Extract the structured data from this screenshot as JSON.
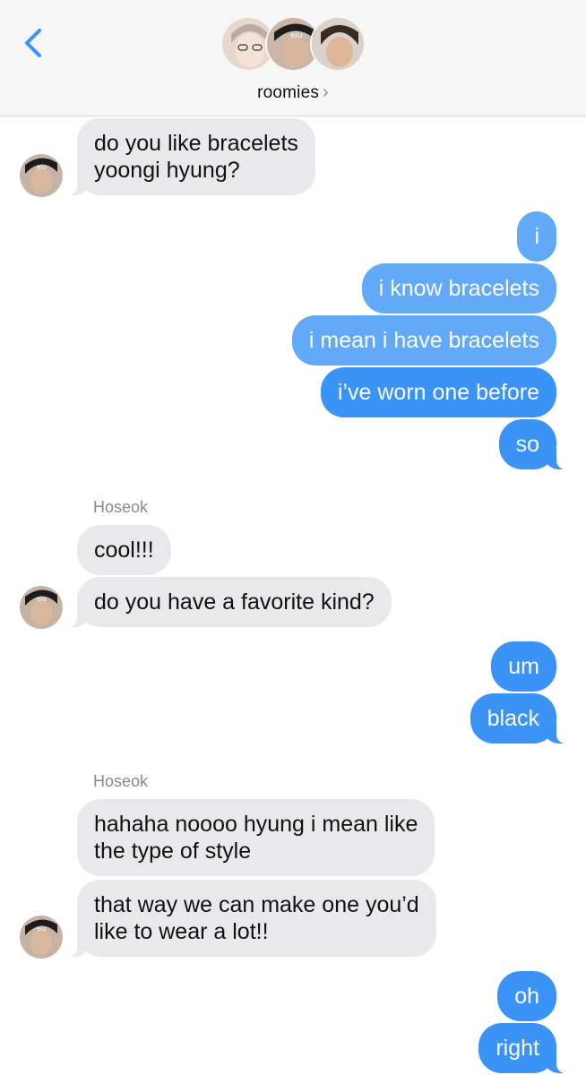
{
  "header": {
    "group_name": "roomies",
    "chevron": "›",
    "back_icon": "chevron-left-icon",
    "accent": "#3b93f5"
  },
  "messages": [
    {
      "from": "other",
      "text_lines": [
        "do you like bracelets",
        "yoongi hyung?"
      ]
    },
    {
      "from": "me",
      "text": "i"
    },
    {
      "from": "me",
      "text": "i know bracelets"
    },
    {
      "from": "me",
      "text": "i mean i have bracelets"
    },
    {
      "from": "me",
      "text": "i’ve worn one before"
    },
    {
      "from": "me",
      "text": "so"
    },
    {
      "sender": "Hoseok"
    },
    {
      "from": "other",
      "text": "cool!!!"
    },
    {
      "from": "other",
      "text": "do you have a favorite kind?"
    },
    {
      "from": "me",
      "text": "um"
    },
    {
      "from": "me",
      "text": "black"
    },
    {
      "sender": "Hoseok"
    },
    {
      "from": "other",
      "text_lines": [
        "hahaha noooo hyung i mean like",
        "the type of style"
      ]
    },
    {
      "from": "other",
      "text_lines": [
        "that way we can make one you’d",
        "like to wear a lot!!"
      ]
    },
    {
      "from": "me",
      "text": "oh"
    },
    {
      "from": "me",
      "text": "right"
    }
  ],
  "colors": {
    "incoming_bubble": "#e9e9eb",
    "outgoing_bubble": "#3b93f5",
    "sender_label": "#8a8a8e"
  }
}
